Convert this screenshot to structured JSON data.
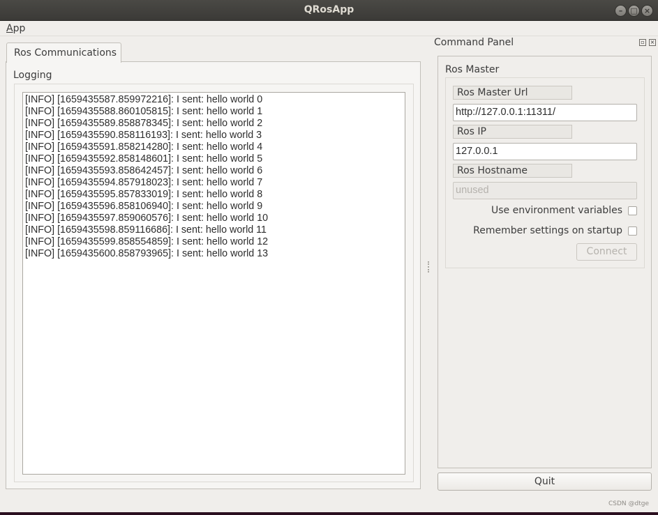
{
  "window": {
    "title": "QRosApp",
    "controls": {
      "minimize": "–",
      "maximize": "□",
      "close": "×"
    }
  },
  "menu": {
    "app_label_underlined": "A",
    "app_label_rest": "pp"
  },
  "tabs": [
    {
      "label": "Ros Communications",
      "active": true
    }
  ],
  "logging": {
    "title": "Logging",
    "lines": [
      "[INFO] [1659435587.859972216]: I sent: hello world 0",
      "[INFO] [1659435588.860105815]: I sent: hello world 1",
      "[INFO] [1659435589.858878345]: I sent: hello world 2",
      "[INFO] [1659435590.858116193]: I sent: hello world 3",
      "[INFO] [1659435591.858214280]: I sent: hello world 4",
      "[INFO] [1659435592.858148601]: I sent: hello world 5",
      "[INFO] [1659435593.858642457]: I sent: hello world 6",
      "[INFO] [1659435594.857918023]: I sent: hello world 7",
      "[INFO] [1659435595.857833019]: I sent: hello world 8",
      "[INFO] [1659435596.858106940]: I sent: hello world 9",
      "[INFO] [1659435597.859060576]: I sent: hello world 10",
      "[INFO] [1659435598.859116686]: I sent: hello world 11",
      "[INFO] [1659435599.858554859]: I sent: hello world 12",
      "[INFO] [1659435600.858793965]: I sent: hello world 13"
    ]
  },
  "command_panel": {
    "title": "Command Panel",
    "ros_master": {
      "title": "Ros Master",
      "master_url_label": "Ros Master Url",
      "master_url_value": "http://127.0.0.1:11311/",
      "ros_ip_label": "Ros IP",
      "ros_ip_value": "127.0.0.1",
      "hostname_label": "Ros Hostname",
      "hostname_placeholder": "unused",
      "use_env_label": "Use environment variables",
      "use_env_checked": false,
      "remember_label": "Remember settings on startup",
      "remember_checked": false,
      "connect_label": "Connect"
    },
    "quit_label": "Quit"
  },
  "watermark": "CSDN @dtge"
}
